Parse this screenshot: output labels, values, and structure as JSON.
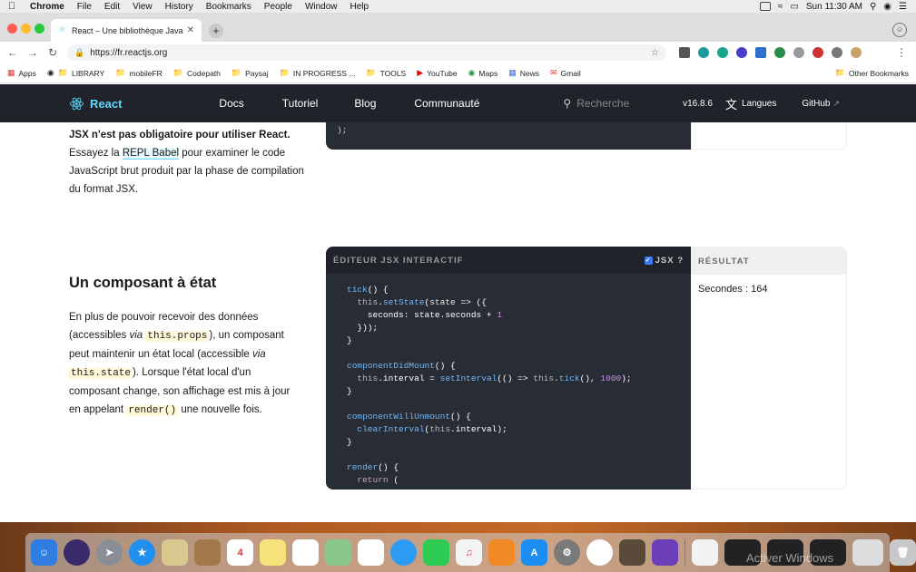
{
  "menubar": {
    "items": [
      "Chrome",
      "File",
      "Edit",
      "View",
      "History",
      "Bookmarks",
      "People",
      "Window",
      "Help"
    ],
    "clock": "Sun 11:30 AM"
  },
  "browser": {
    "tab_title": "React – Une bibliothèque Java",
    "new_tab": "+",
    "url": "https://fr.reactjs.org"
  },
  "bookmarks": [
    "Apps",
    "LIBRARY",
    "mobileFR",
    "Codepath",
    "Paysaj",
    "IN PROGRESS ...",
    "TOOLS",
    "YouTube",
    "Maps",
    "News",
    "Gmail"
  ],
  "other_bookmarks": "Other Bookmarks",
  "reactnav": {
    "brand": "React",
    "links": [
      "Docs",
      "Tutoriel",
      "Blog",
      "Communauté"
    ],
    "search_placeholder": "Recherche",
    "version": "v16.8.6",
    "languages": "Langues",
    "github": "GitHub"
  },
  "intro": {
    "bold": "JSX n'est pas obligatoire pour utiliser React.",
    "before_link": " Essayez la ",
    "link": "REPL Babel",
    "after_link": " pour examiner le code JavaScript brut produit par la phase de compilation du format JSX."
  },
  "top_code_tail": ");",
  "section": {
    "title": "Un composant à état",
    "p_a": "En plus de pouvoir recevoir des données (accessibles ",
    "via": "via",
    "props": "this.props",
    "p_b": "), un composant peut maintenir un état local (accessible ",
    "via2": "via",
    "state": "this.state",
    "p_c": "). Lorsque l'état local d'un composant change, son affichage est mis à jour en appelant ",
    "render": "render()",
    "p_d": " une nouvelle fois."
  },
  "editor": {
    "header": "ÉDITEUR JSX INTERACTIF",
    "jsx_toggle": "JSX ?",
    "result_header": "RÉSULTAT",
    "result_text": "Secondes : 164"
  },
  "dock_watermark": "Activer Windows",
  "colors": {
    "react_blue": "#61dafb",
    "nav_bg": "#20232a",
    "editor_bg": "#282c34"
  }
}
